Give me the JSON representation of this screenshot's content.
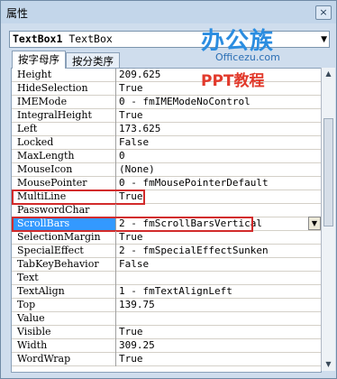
{
  "window": {
    "title": "属性",
    "close_glyph": "×"
  },
  "object_selector": {
    "name": "TextBox1",
    "type": "TextBox"
  },
  "tabs": [
    {
      "label": "按字母序",
      "active": true
    },
    {
      "label": "按分类序",
      "active": false
    }
  ],
  "watermark": {
    "main": "办公族",
    "site": "Officezu.com",
    "sub": "PPT教程"
  },
  "properties": [
    {
      "name": "Height",
      "value": "209.625"
    },
    {
      "name": "HideSelection",
      "value": "True"
    },
    {
      "name": "IMEMode",
      "value": "0 - fmIMEModeNoControl"
    },
    {
      "name": "IntegralHeight",
      "value": "True"
    },
    {
      "name": "Left",
      "value": "173.625"
    },
    {
      "name": "Locked",
      "value": "False"
    },
    {
      "name": "MaxLength",
      "value": "0"
    },
    {
      "name": "MouseIcon",
      "value": "(None)"
    },
    {
      "name": "MousePointer",
      "value": "0 - fmMousePointerDefault"
    },
    {
      "name": "MultiLine",
      "value": "True"
    },
    {
      "name": "PasswordChar",
      "value": ""
    },
    {
      "name": "ScrollBars",
      "value": "2 - fmScrollBarsVertical"
    },
    {
      "name": "SelectionMargin",
      "value": "True"
    },
    {
      "name": "SpecialEffect",
      "value": "2 - fmSpecialEffectSunken"
    },
    {
      "name": "TabKeyBehavior",
      "value": "False"
    },
    {
      "name": "Text",
      "value": ""
    },
    {
      "name": "TextAlign",
      "value": "1 - fmTextAlignLeft"
    },
    {
      "name": "Top",
      "value": "139.75"
    },
    {
      "name": "Value",
      "value": ""
    },
    {
      "name": "Visible",
      "value": "True"
    },
    {
      "name": "Width",
      "value": "309.25"
    },
    {
      "name": "WordWrap",
      "value": "True"
    }
  ],
  "selected_property": "ScrollBars",
  "highlighted_properties": [
    "MultiLine",
    "ScrollBars"
  ],
  "colors": {
    "selection": "#3399ff",
    "highlight_box": "#d22b2b",
    "logo_blue": "#2b8de0",
    "logo_red": "#e23a2c"
  }
}
